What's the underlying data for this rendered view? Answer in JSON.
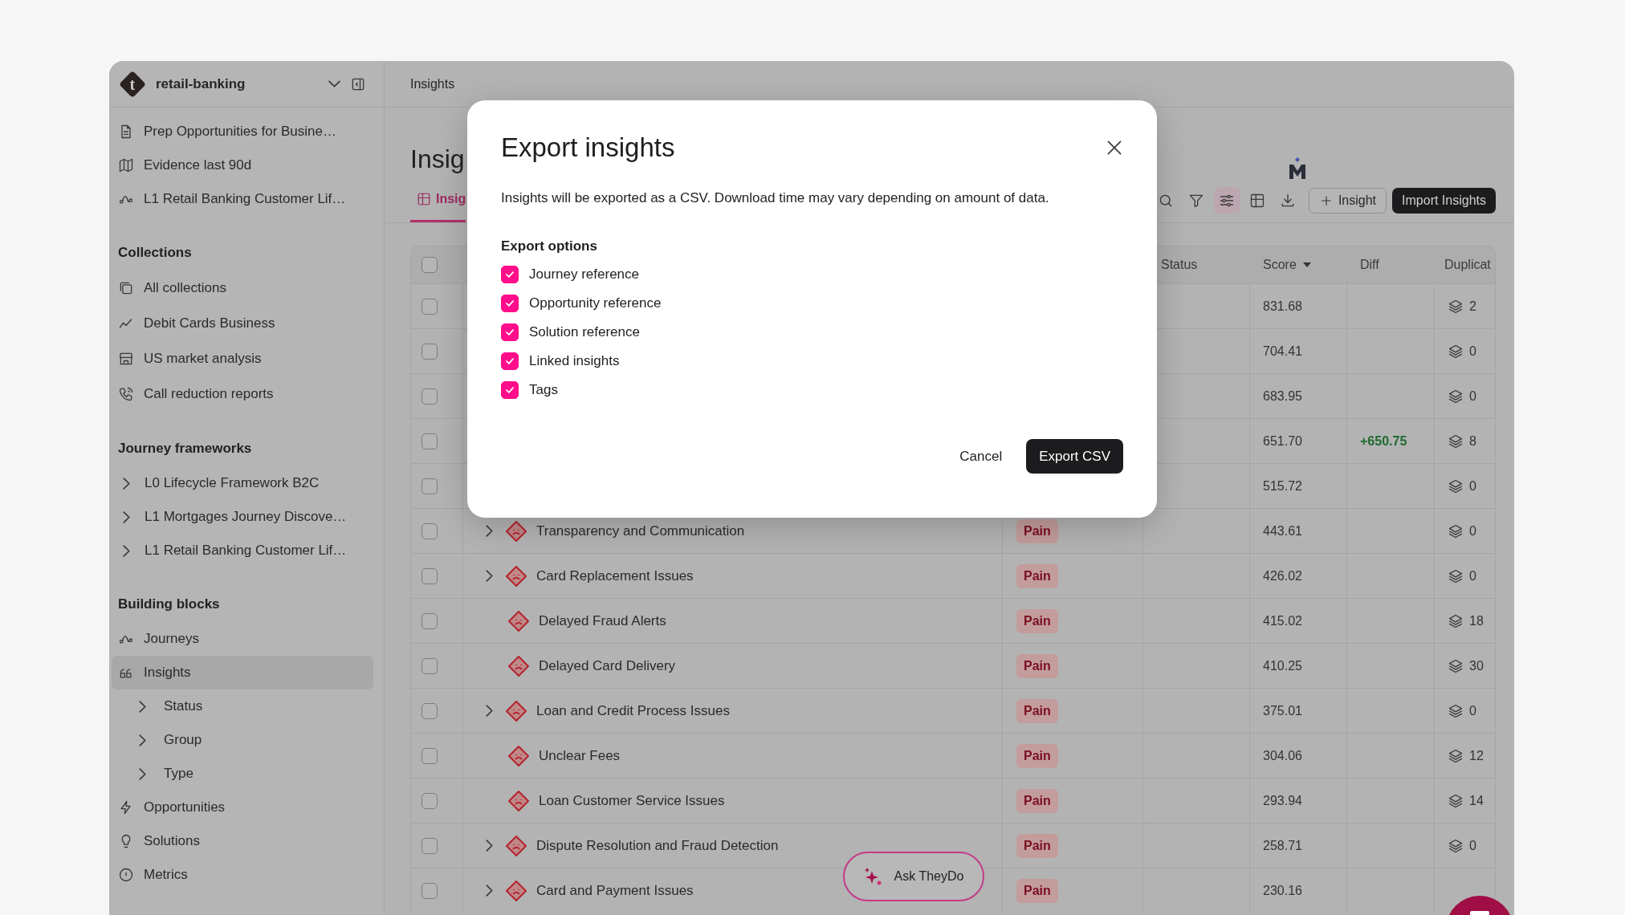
{
  "sidebar": {
    "logo_letter": "t",
    "workspace": "retail-banking",
    "pinned": [
      {
        "label": "Prep Opportunities for Busine…",
        "selected": false
      },
      {
        "label": "Evidence last 90d",
        "selected": false
      },
      {
        "label": "L1 Retail Banking Customer Lif…",
        "selected": false
      }
    ],
    "sections": [
      {
        "title": "Collections",
        "items": [
          {
            "kind": "link",
            "label": "All collections",
            "selected": false
          },
          {
            "kind": "link",
            "label": "Debit Cards Business",
            "selected": false
          },
          {
            "kind": "link",
            "label": "US market analysis",
            "selected": false
          },
          {
            "kind": "link",
            "label": "Call reduction reports",
            "selected": false
          }
        ]
      },
      {
        "title": "Journey frameworks",
        "items": [
          {
            "kind": "tree",
            "label": "L0 Lifecycle Framework B2C",
            "selected": false,
            "expanded": false
          },
          {
            "kind": "tree",
            "label": "L1 Mortgages Journey Discove…",
            "selected": false,
            "expanded": false
          },
          {
            "kind": "tree",
            "label": "L1 Retail Banking Customer Lif…",
            "selected": false,
            "expanded": false
          }
        ]
      },
      {
        "title": "Building blocks",
        "items": [
          {
            "kind": "link",
            "label": "Journeys",
            "selected": false
          },
          {
            "kind": "link",
            "label": "Insights",
            "selected": true,
            "children": [
              {
                "kind": "tree",
                "label": "Status",
                "selected": false,
                "expanded": false
              },
              {
                "kind": "tree",
                "label": "Group",
                "selected": false,
                "expanded": false
              },
              {
                "kind": "tree",
                "label": "Type",
                "selected": false,
                "expanded": false
              }
            ]
          },
          {
            "kind": "link",
            "label": "Opportunities",
            "selected": false
          },
          {
            "kind": "link",
            "label": "Solutions",
            "selected": false
          },
          {
            "kind": "link",
            "label": "Metrics",
            "selected": false
          }
        ]
      }
    ]
  },
  "main": {
    "breadcrumb": "Insights",
    "title": "Insig",
    "tab": {
      "label": "Insig",
      "selected": true
    },
    "toolbar": {
      "tools": [
        {
          "selected": false
        },
        {
          "selected": false
        },
        {
          "selected": true
        },
        {
          "selected": false
        },
        {
          "selected": false
        }
      ],
      "add_button": "Insight",
      "import_button": "Import Insights"
    },
    "table": {
      "header_checkbox": {
        "checked": false
      },
      "columns": [
        {
          "label": "Status"
        },
        {
          "label": "Score",
          "sorted_descending": true
        },
        {
          "label": "Diff"
        },
        {
          "label": "Duplicat"
        }
      ],
      "rows": [
        {
          "checked": false,
          "score": "831.68",
          "duplicates": "2"
        },
        {
          "checked": false,
          "score": "704.41",
          "duplicates": "0"
        },
        {
          "checked": false,
          "score": "683.95",
          "duplicates": "0"
        },
        {
          "checked": false,
          "score": "651.70",
          "diff": "+650.75",
          "duplicates": "8"
        },
        {
          "checked": false,
          "score": "515.72",
          "duplicates": "0"
        },
        {
          "checked": false,
          "insight": {
            "name": "Transparency and Communication",
            "expandable": true,
            "type": "Pain"
          },
          "score": "443.61",
          "duplicates": "0"
        },
        {
          "checked": false,
          "insight": {
            "name": "Card Replacement Issues",
            "expandable": true,
            "type": "Pain"
          },
          "score": "426.02",
          "duplicates": "0"
        },
        {
          "checked": false,
          "insight": {
            "name": "Delayed Fraud Alerts",
            "expandable": false,
            "type": "Pain"
          },
          "score": "415.02",
          "duplicates": "18"
        },
        {
          "checked": false,
          "insight": {
            "name": "Delayed Card Delivery",
            "expandable": false,
            "type": "Pain"
          },
          "score": "410.25",
          "duplicates": "30"
        },
        {
          "checked": false,
          "insight": {
            "name": "Loan and Credit Process Issues",
            "expandable": true,
            "type": "Pain"
          },
          "score": "375.01",
          "duplicates": "0"
        },
        {
          "checked": false,
          "insight": {
            "name": "Unclear Fees",
            "expandable": false,
            "type": "Pain"
          },
          "score": "304.06",
          "duplicates": "12"
        },
        {
          "checked": false,
          "insight": {
            "name": "Loan Customer Service Issues",
            "expandable": false,
            "type": "Pain"
          },
          "score": "293.94",
          "duplicates": "14"
        },
        {
          "checked": false,
          "insight": {
            "name": "Dispute Resolution and Fraud Detection",
            "expandable": true,
            "type": "Pain"
          },
          "score": "258.71",
          "duplicates": "0"
        },
        {
          "checked": false,
          "insight": {
            "name": "Card and Payment Issues",
            "expandable": true,
            "type": "Pain"
          },
          "score": "230.16"
        }
      ]
    },
    "ask_button": "Ask TheyDo"
  },
  "modal": {
    "title": "Export insights",
    "description": "Insights will be exported as a CSV. Download time may vary depending on amount of data.",
    "options_label": "Export options",
    "options": [
      {
        "label": "Journey reference",
        "checked": true
      },
      {
        "label": "Opportunity reference",
        "checked": true
      },
      {
        "label": "Solution reference",
        "checked": true
      },
      {
        "label": "Linked insights",
        "checked": true
      },
      {
        "label": "Tags",
        "checked": true
      }
    ],
    "cancel": "Cancel",
    "confirm": "Export CSV"
  }
}
